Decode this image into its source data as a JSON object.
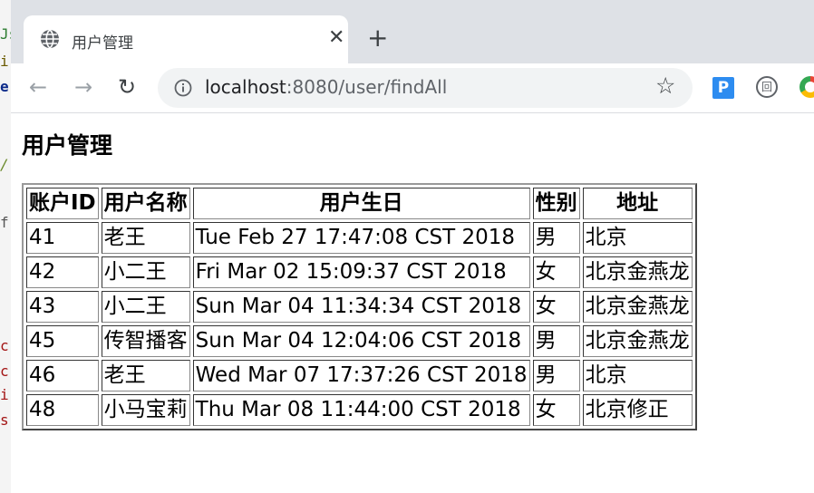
{
  "background_window": {
    "fragments": [
      {
        "text": "Js",
        "color": "#2e7d32"
      },
      {
        "text": "i",
        "color": "#6a5a00"
      },
      {
        "text": "e",
        "color": "#0d2b8a"
      },
      {
        "text": "/l",
        "color": "#6a8a2b"
      },
      {
        "text": "f",
        "color": "#555555"
      },
      {
        "text": "c",
        "color": "#a31515"
      },
      {
        "text": "c",
        "color": "#a31515"
      },
      {
        "text": "i",
        "color": "#a31515"
      },
      {
        "text": "s",
        "color": "#a31515"
      }
    ]
  },
  "browser": {
    "tab": {
      "title": "用户管理",
      "close_glyph": "✕",
      "favicon": "globe-icon"
    },
    "new_tab_glyph": "+",
    "toolbar": {
      "back_glyph": "←",
      "forward_glyph": "→",
      "reload_glyph": "↻",
      "url_host": "localhost",
      "url_rest": ":8080/user/findAll",
      "bookmark_glyph": "☆"
    },
    "extensions": {
      "p_label": "P",
      "circle_label": "回"
    }
  },
  "page": {
    "heading": "用户管理",
    "table": {
      "headers": [
        "账户ID",
        "用户名称",
        "用户生日",
        "性别",
        "地址"
      ],
      "rows": [
        [
          "41",
          "老王",
          "Tue Feb 27 17:47:08 CST 2018",
          "男",
          "北京"
        ],
        [
          "42",
          "小二王",
          "Fri Mar 02 15:09:37 CST 2018",
          "女",
          "北京金燕龙"
        ],
        [
          "43",
          "小二王",
          "Sun Mar 04 11:34:34 CST 2018",
          "女",
          "北京金燕龙"
        ],
        [
          "45",
          "传智播客",
          "Sun Mar 04 12:04:06 CST 2018",
          "男",
          "北京金燕龙"
        ],
        [
          "46",
          "老王",
          "Wed Mar 07 17:37:26 CST 2018",
          "男",
          "北京"
        ],
        [
          "48",
          "小马宝莉",
          "Thu Mar 08 11:44:00 CST 2018",
          "女",
          "北京修正"
        ]
      ]
    }
  },
  "colors": {
    "tabstrip": "#dee1e6",
    "omnibox": "#f1f3f4",
    "ext_p": "#2d8cf0"
  }
}
